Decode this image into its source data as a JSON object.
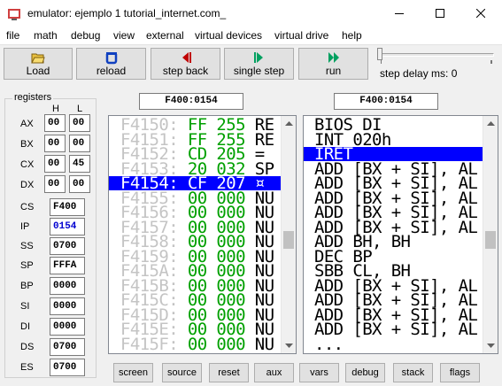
{
  "window": {
    "title": "emulator: ejemplo 1 tutorial_internet.com_"
  },
  "menu": [
    "file",
    "math",
    "debug",
    "view",
    "external",
    "virtual devices",
    "virtual drive",
    "help"
  ],
  "toolbar": {
    "buttons": [
      {
        "label": "Load",
        "icon": "folder-open-icon"
      },
      {
        "label": "reload",
        "icon": "reload-icon"
      },
      {
        "label": "step back",
        "icon": "step-back-icon"
      },
      {
        "label": "single step",
        "icon": "single-step-icon"
      },
      {
        "label": "run",
        "icon": "run-icon"
      }
    ],
    "step_delay_label": "step delay ms: 0",
    "step_delay_value": 0
  },
  "registers": {
    "title": "registers",
    "h_label": "H",
    "l_label": "L",
    "general": [
      {
        "name": "AX",
        "h": "00",
        "l": "00"
      },
      {
        "name": "BX",
        "h": "00",
        "l": "00"
      },
      {
        "name": "CX",
        "h": "00",
        "l": "45"
      },
      {
        "name": "DX",
        "h": "00",
        "l": "00"
      }
    ],
    "segment": [
      {
        "name": "CS",
        "value": "F400"
      },
      {
        "name": "IP",
        "value": "0154"
      },
      {
        "name": "SS",
        "value": "0700"
      },
      {
        "name": "SP",
        "value": "FFFA"
      },
      {
        "name": "BP",
        "value": "0000"
      },
      {
        "name": "SI",
        "value": "0000"
      },
      {
        "name": "DI",
        "value": "0000"
      },
      {
        "name": "DS",
        "value": "0700"
      },
      {
        "name": "ES",
        "value": "0700"
      }
    ]
  },
  "memory": {
    "address": "F400:0154",
    "lines": [
      {
        "addr": "F4150:",
        "hex": "FF",
        "dec": "255",
        "ch": "RE"
      },
      {
        "addr": "F4151:",
        "hex": "FF",
        "dec": "255",
        "ch": "RE"
      },
      {
        "addr": "F4152:",
        "hex": "CD",
        "dec": "205",
        "ch": "="
      },
      {
        "addr": "F4153:",
        "hex": "20",
        "dec": "032",
        "ch": "SP"
      },
      {
        "addr": "F4154:",
        "hex": "CF",
        "dec": "207",
        "ch": "¤"
      },
      {
        "addr": "F4155:",
        "hex": "00",
        "dec": "000",
        "ch": "NU"
      },
      {
        "addr": "F4156:",
        "hex": "00",
        "dec": "000",
        "ch": "NU"
      },
      {
        "addr": "F4157:",
        "hex": "00",
        "dec": "000",
        "ch": "NU"
      },
      {
        "addr": "F4158:",
        "hex": "00",
        "dec": "000",
        "ch": "NU"
      },
      {
        "addr": "F4159:",
        "hex": "00",
        "dec": "000",
        "ch": "NU"
      },
      {
        "addr": "F415A:",
        "hex": "00",
        "dec": "000",
        "ch": "NU"
      },
      {
        "addr": "F415B:",
        "hex": "00",
        "dec": "000",
        "ch": "NU"
      },
      {
        "addr": "F415C:",
        "hex": "00",
        "dec": "000",
        "ch": "NU"
      },
      {
        "addr": "F415D:",
        "hex": "00",
        "dec": "000",
        "ch": "NU"
      },
      {
        "addr": "F415E:",
        "hex": "00",
        "dec": "000",
        "ch": "NU"
      },
      {
        "addr": "F415F:",
        "hex": "00",
        "dec": "000",
        "ch": "NU"
      }
    ],
    "selected_index": 4
  },
  "disasm": {
    "address": "F400:0154",
    "lines": [
      "BIOS DI",
      "INT 020h",
      "IRET",
      "ADD [BX + SI], AL",
      "ADD [BX + SI], AL",
      "ADD [BX + SI], AL",
      "ADD [BX + SI], AL",
      "ADD [BX + SI], AL",
      "ADD BH, BH",
      "DEC BP",
      "SBB CL, BH",
      "ADD [BX + SI], AL",
      "ADD [BX + SI], AL",
      "ADD [BX + SI], AL",
      "ADD [BX + SI], AL",
      "..."
    ],
    "selected_index": 2
  },
  "bottom_buttons": [
    "screen",
    "source",
    "reset",
    "aux",
    "vars",
    "debug",
    "stack",
    "flags"
  ]
}
